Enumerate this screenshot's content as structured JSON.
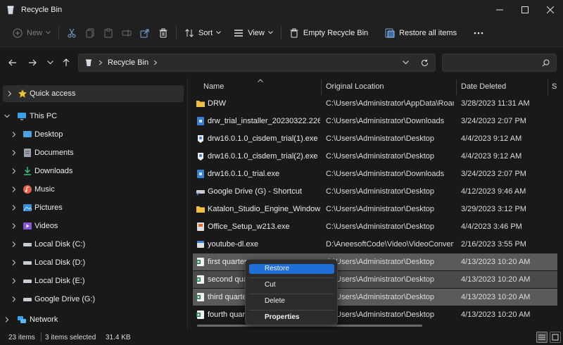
{
  "window": {
    "title": "Recycle Bin",
    "icons": {
      "app": "recycle-bin-icon",
      "minimize": "minimize-icon",
      "maximize": "maximize-icon",
      "close": "close-icon"
    }
  },
  "toolbar": {
    "new_label": "New",
    "sort_label": "Sort",
    "view_label": "View",
    "empty_label": "Empty Recycle Bin",
    "restore_all_label": "Restore all items",
    "icons": [
      "cut-icon",
      "copy-icon",
      "paste-icon",
      "rename-icon",
      "share-icon",
      "delete-icon",
      "sort-icon",
      "view-icon",
      "more-icon"
    ]
  },
  "address": {
    "path": "Recycle Bin",
    "search_placeholder": ""
  },
  "sidebar": {
    "items": [
      {
        "label": "Quick access",
        "icon": "star-icon"
      },
      {
        "label": "This PC",
        "icon": "pc-icon"
      },
      {
        "label": "Desktop",
        "icon": "desktop-icon"
      },
      {
        "label": "Documents",
        "icon": "documents-icon"
      },
      {
        "label": "Downloads",
        "icon": "downloads-icon"
      },
      {
        "label": "Music",
        "icon": "music-icon"
      },
      {
        "label": "Pictures",
        "icon": "pictures-icon"
      },
      {
        "label": "Videos",
        "icon": "videos-icon"
      },
      {
        "label": "Local Disk (C:)",
        "icon": "drive-icon"
      },
      {
        "label": "Local Disk (D:)",
        "icon": "drive-icon"
      },
      {
        "label": "Local Disk (E:)",
        "icon": "drive-icon"
      },
      {
        "label": "Google Drive (G:)",
        "icon": "drive-icon"
      },
      {
        "label": "Network",
        "icon": "network-icon"
      }
    ]
  },
  "columns": {
    "name": "Name",
    "location": "Original Location",
    "date": "Date Deleted",
    "extra": "S"
  },
  "files": [
    {
      "name": "DRW",
      "location": "C:\\Users\\Administrator\\AppData\\Roami...",
      "date": "3/28/2023 11:31 AM",
      "icon": "folder-icon"
    },
    {
      "name": "drw_trial_installer_20230322.226.exe",
      "location": "C:\\Users\\Administrator\\Downloads",
      "date": "3/24/2023 2:07 PM",
      "icon": "installer-icon"
    },
    {
      "name": "drw16.0.1.0_cisdem_trial(1).exe",
      "location": "C:\\Users\\Administrator\\Desktop",
      "date": "4/4/2023 9:12 AM",
      "icon": "app-exe-icon"
    },
    {
      "name": "drw16.0.1.0_cisdem_trial(2).exe",
      "location": "C:\\Users\\Administrator\\Desktop",
      "date": "4/4/2023 9:12 AM",
      "icon": "app-exe-icon"
    },
    {
      "name": "drw16.0.1.0_trial.exe",
      "location": "C:\\Users\\Administrator\\Downloads",
      "date": "3/24/2023 2:07 PM",
      "icon": "installer-icon"
    },
    {
      "name": "Google Drive (G) - Shortcut",
      "location": "C:\\Users\\Administrator\\Desktop",
      "date": "4/12/2023 9:46 AM",
      "icon": "shortcut-icon"
    },
    {
      "name": "Katalon_Studio_Engine_Windows_6...",
      "location": "C:\\Users\\Administrator\\Desktop",
      "date": "3/29/2023 3:12 PM",
      "icon": "folder-icon"
    },
    {
      "name": "Office_Setup_w213.exe",
      "location": "C:\\Users\\Administrator\\Desktop",
      "date": "4/4/2023 3:46 PM",
      "icon": "setup-icon"
    },
    {
      "name": "youtube-dl.exe",
      "location": "D:\\AneesoftCode\\Video\\VideoConverter...",
      "date": "2/16/2023 3:55 PM",
      "icon": "exe-icon"
    },
    {
      "name": "first quarter.x",
      "location": "C:\\Users\\Administrator\\Desktop",
      "date": "4/13/2023 10:20 AM",
      "icon": "excel-icon"
    },
    {
      "name": "second quar",
      "location": "C:\\Users\\Administrator\\Desktop",
      "date": "4/13/2023 10:20 AM",
      "icon": "excel-icon"
    },
    {
      "name": "third quarter",
      "location": "C:\\Users\\Administrator\\Desktop",
      "date": "4/13/2023 10:20 AM",
      "icon": "excel-icon"
    },
    {
      "name": "fourth quarte",
      "location": "C:\\Users\\Administrator\\Desktop",
      "date": "4/13/2023 10:20 AM",
      "icon": "excel-icon"
    }
  ],
  "context_menu": {
    "restore": "Restore",
    "cut": "Cut",
    "delete": "Delete",
    "properties": "Properties"
  },
  "status": {
    "count": "23 items",
    "selected": "3 items selected",
    "size": "31.4 KB"
  },
  "colors": {
    "accent": "#1f6fd6",
    "background": "#191919",
    "chrome": "#202020"
  }
}
